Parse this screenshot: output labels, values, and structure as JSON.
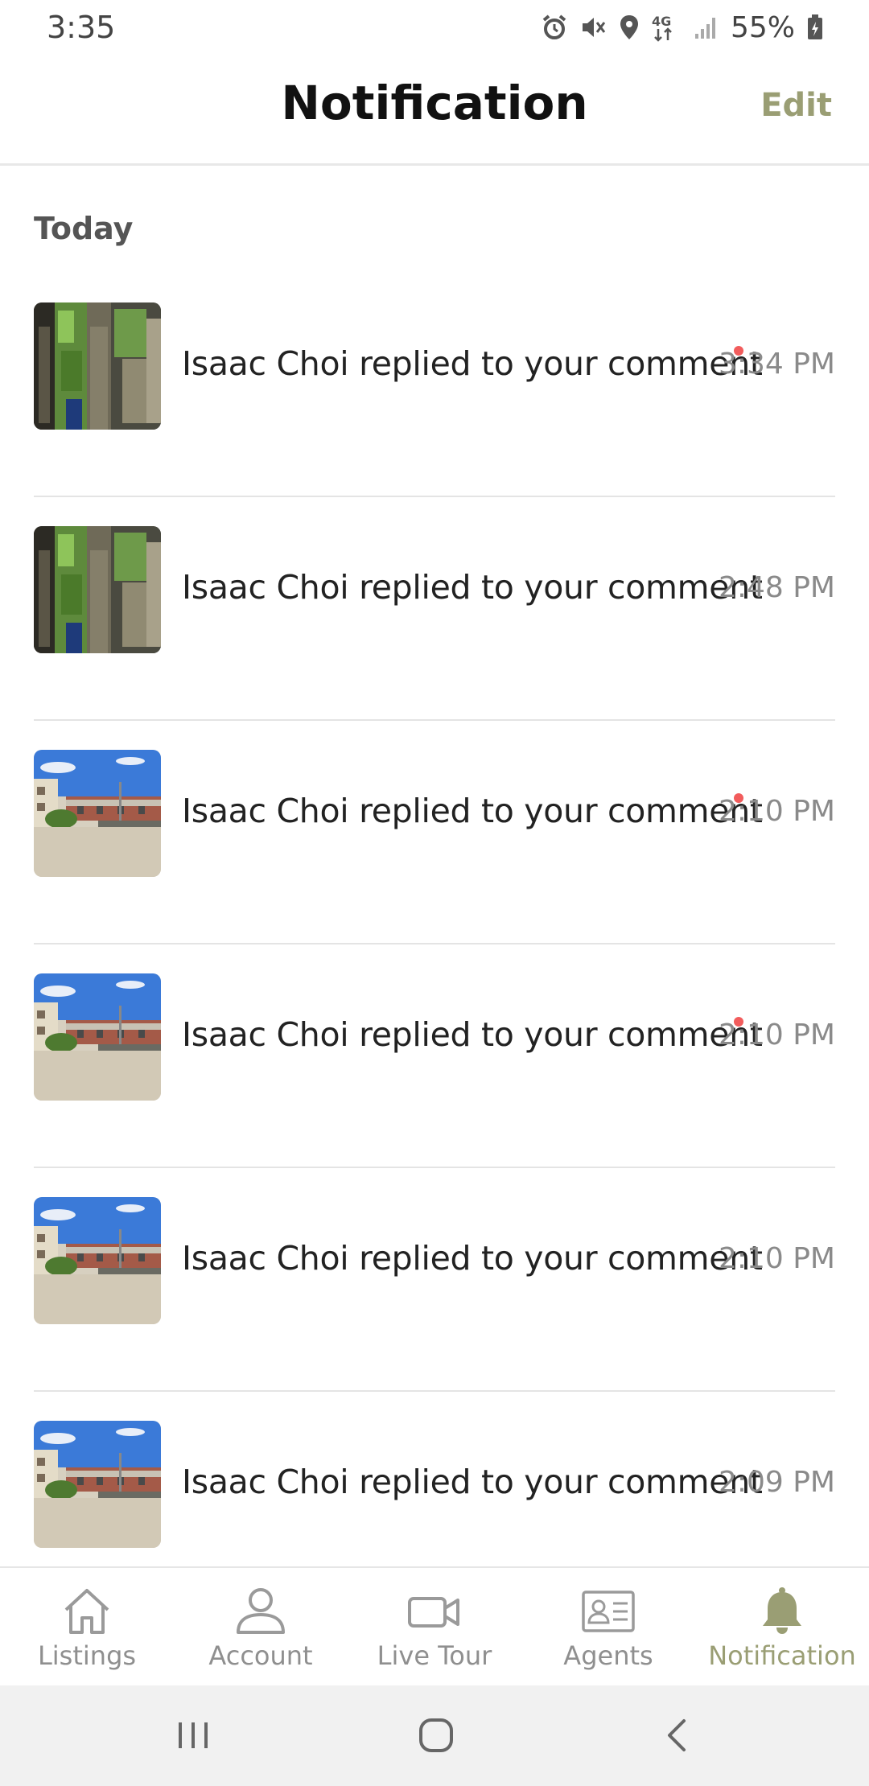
{
  "status_bar": {
    "time": "3:35",
    "network": "4G",
    "battery": "55%"
  },
  "header": {
    "title": "Notification",
    "edit_label": "Edit"
  },
  "section": {
    "label": "Today"
  },
  "notifications": [
    {
      "text": "Isaac Choi replied to your comment",
      "time": "3:34 PM",
      "unread": true,
      "thumbnail": "shelf-photo"
    },
    {
      "text": "Isaac Choi replied to your comment",
      "time": "2:48 PM",
      "unread": false,
      "thumbnail": "shelf-photo"
    },
    {
      "text": "Isaac Choi replied to your comment",
      "time": "2:10 PM",
      "unread": true,
      "thumbnail": "courtyard-photo"
    },
    {
      "text": "Isaac Choi replied to your comment",
      "time": "2:10 PM",
      "unread": true,
      "thumbnail": "courtyard-photo"
    },
    {
      "text": "Isaac Choi replied to your comment",
      "time": "2:10 PM",
      "unread": false,
      "thumbnail": "courtyard-photo"
    },
    {
      "text": "Isaac Choi replied to your comment",
      "time": "2:09 PM",
      "unread": false,
      "thumbnail": "courtyard-photo"
    }
  ],
  "bottom_nav": {
    "items": [
      {
        "label": "Listings",
        "icon": "home-icon",
        "active": false
      },
      {
        "label": "Account",
        "icon": "person-icon",
        "active": false
      },
      {
        "label": "Live Tour",
        "icon": "video-camera-icon",
        "active": false
      },
      {
        "label": "Agents",
        "icon": "id-card-icon",
        "active": false
      },
      {
        "label": "Notification",
        "icon": "bell-icon",
        "active": true
      }
    ]
  },
  "colors": {
    "accent": "#9a9e74",
    "unread_dot": "#f25c5c",
    "divider": "#e4e4e4",
    "muted_text": "#8a8a8a"
  }
}
